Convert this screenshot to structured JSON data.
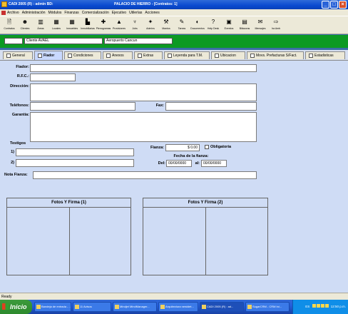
{
  "window": {
    "app_title": "CADI 2005 (R) : admin   BD:",
    "center_title": "PALACIO DE HIERRO - [Contratos: 1]"
  },
  "menu": [
    "Archivo",
    "Administración",
    "Módulos",
    "Finanzas",
    "Comercialización",
    "Ejecutivo",
    "Utilerías",
    "Acciones"
  ],
  "toolbar": [
    {
      "label": "Contratos",
      "icon": "document-icon",
      "glyph": "🗎"
    },
    {
      "label": "Clientes",
      "icon": "person-icon",
      "glyph": "☻"
    },
    {
      "label": "Áreas",
      "icon": "area-icon",
      "glyph": "▥"
    },
    {
      "label": "Locales",
      "icon": "building-icon",
      "glyph": "▦"
    },
    {
      "label": "Inmuebles",
      "icon": "buildings-icon",
      "glyph": "▦"
    },
    {
      "label": "Inmobiliarias",
      "icon": "company-icon",
      "glyph": "▙"
    },
    {
      "label": "Plenogramas",
      "icon": "plan-icon",
      "glyph": "✚"
    },
    {
      "label": "Provisiones",
      "icon": "provision-icon",
      "glyph": "▲"
    },
    {
      "label": "Jobs",
      "icon": "jobs-icon",
      "glyph": "♆"
    },
    {
      "label": "Admins",
      "icon": "admins-icon",
      "glyph": "✦"
    },
    {
      "label": "Mantos",
      "icon": "tools-icon",
      "glyph": "⚒"
    },
    {
      "label": "Tareas",
      "icon": "tasks-icon",
      "glyph": "✎"
    },
    {
      "label": "Documentos",
      "icon": "docs-icon",
      "glyph": "◐"
    },
    {
      "label": "Help Desk",
      "icon": "help-icon",
      "glyph": "?"
    },
    {
      "label": "Eventos",
      "icon": "events-icon",
      "glyph": "▣"
    },
    {
      "label": "Bitácoras",
      "icon": "log-icon",
      "glyph": "▤"
    },
    {
      "label": "Mensajes",
      "icon": "messages-icon",
      "glyph": "✉"
    },
    {
      "label": "Ira Amb",
      "icon": "exit-icon",
      "glyph": "⇨"
    }
  ],
  "header": {
    "client": "Cliente AVAEL",
    "location": "Aeropuerto Cancun"
  },
  "tabs": [
    {
      "label": "General",
      "icon": "general-tab-icon"
    },
    {
      "label": "Fiador",
      "icon": "guarantor-tab-icon"
    },
    {
      "label": "Condiciones",
      "icon": "conditions-tab-icon"
    },
    {
      "label": "Anexos",
      "icon": "annex-tab-icon"
    },
    {
      "label": "Extras",
      "icon": "extras-tab-icon"
    },
    {
      "label": "Leyenda para T.M.",
      "icon": "legend-tab-icon"
    },
    {
      "label": "Ubicacion",
      "icon": "location-tab-icon"
    },
    {
      "label": "Movs. Prefacturas S/Fact.",
      "icon": "movements-tab-icon"
    },
    {
      "label": "Estadisticas",
      "icon": "stats-tab-icon"
    }
  ],
  "form": {
    "fiador_label": "Fiador:",
    "fiador_value": "",
    "rfc_label": "R.F.C.:",
    "rfc_value": "",
    "direccion_label": "Dirección:",
    "direccion_value": "",
    "telefonos_label": "Teléfonos:",
    "telefonos_value": "",
    "fax_label": "Fax:",
    "fax_value": "",
    "garantia_label": "Garantía:",
    "garantia_value": "",
    "testigos_label": "Testigos",
    "testigo1_label": "1)",
    "testigo1_value": "",
    "testigo2_label": "2)",
    "testigo2_value": "",
    "fianza_label": "Fianza:",
    "fianza_value": "$ 0.00",
    "obligatoria_label": "Obligatoria",
    "obligatoria_checked": false,
    "fecha_fianza_label": "Fecha de la fianza:",
    "del_label": "Del:",
    "del_value": "00/00/0000",
    "al_label": "al:",
    "al_value": "00/00/0000",
    "nota_label": "Nota Fianza:",
    "nota_value": ""
  },
  "photos": {
    "panel1_title": "Fotos Y Firma (1)",
    "panel2_title": "Fotos Y Firma (2)"
  },
  "status": {
    "text": "Ready"
  },
  "taskbar": {
    "start": "Inicio",
    "tasks": [
      "Bandeja de entrada - ...",
      "11 Avisos",
      "Mindjet MindManager...",
      "Arquitectura newidet...",
      "CADI 2005 (R) : ad...",
      "SugarCRM - CRM Ini..."
    ],
    "tray_lang": "ES",
    "clock": "12:50 p.m."
  }
}
